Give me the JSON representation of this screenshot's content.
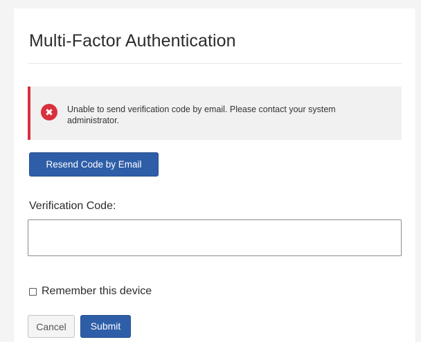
{
  "form": {
    "title": "Multi-Factor Authentication",
    "alert": {
      "icon": "error-circle-icon",
      "icon_glyph": "✖",
      "color": "#d9303e",
      "message": "Unable to send verification code by email. Please contact your system administrator."
    },
    "resend_label": "Resend Code by Email",
    "code_label": "Verification Code:",
    "code_value": "",
    "remember_label": "Remember this device",
    "remember_checked": false,
    "cancel_label": "Cancel",
    "submit_label": "Submit",
    "accent_color": "#2f5ea8"
  }
}
